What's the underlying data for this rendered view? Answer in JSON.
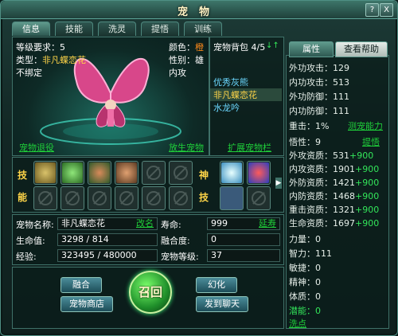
{
  "window": {
    "title": "宠物",
    "help_button": "?",
    "close_button": "X"
  },
  "tabs": [
    "信息",
    "技能",
    "洗灵",
    "提悟",
    "训练"
  ],
  "info": {
    "level_req": "等级要求：5",
    "type_label": "类型：",
    "type_value": "非凡蝶恋花",
    "bind": "不绑定",
    "color_label": "颜色：",
    "color_value": "橙",
    "gender_label": "性别：",
    "gender_value": "雄",
    "attack_type": "内攻",
    "unlink": "宠物退役",
    "reset": "放生宠物"
  },
  "bag": {
    "title": "宠物背包 4/5",
    "items": [
      "优秀灰熊",
      "非凡蝶恋花",
      "水龙吟"
    ],
    "expand": "扩展宠物栏"
  },
  "skills": {
    "label_left": "技\n能",
    "label_right": "神\n技"
  },
  "fields": {
    "name_label": "宠物名称:",
    "name_value": "非凡蝶恋花",
    "rename": "改名",
    "life_label": "寿命:",
    "life_value": "999",
    "extend": "延寿",
    "hp_label": "生命值:",
    "hp_value": "3298 / 814",
    "fusion_label": "融合度:",
    "fusion_value": "0",
    "exp_label": "经验:",
    "exp_value": "323495 / 480000",
    "petlevel_label": "宠物等级:",
    "petlevel_value": "37"
  },
  "buttons": {
    "merge": "融合",
    "shop": "宠物商店",
    "summon": "召回",
    "morph": "幻化",
    "chat": "发到聊天"
  },
  "right_tabs": [
    "属性",
    "查看帮助"
  ],
  "stats": {
    "ext_atk": "外功攻击：129",
    "int_atk": "内功攻击：513",
    "ext_def": "外功防御：111",
    "int_def": "内功防御：111",
    "crit": "重击：1%",
    "measure": "测宠能力",
    "wisdom": "悟性：9",
    "promote": "提悟",
    "apt": [
      {
        "k": "外攻资质：",
        "v": "531",
        "p": "+900"
      },
      {
        "k": "内攻资质：",
        "v": "1901",
        "p": "+900"
      },
      {
        "k": "外防资质：",
        "v": "1421",
        "p": "+900"
      },
      {
        "k": "内防资质：",
        "v": "1468",
        "p": "+900"
      },
      {
        "k": "重击资质：",
        "v": "1321",
        "p": "+900"
      },
      {
        "k": "生命资质：",
        "v": "1697",
        "p": "+900"
      }
    ],
    "attrs": [
      "力量：0",
      "智力：111",
      "敏捷：0",
      "精神：0",
      "体质：0"
    ],
    "potential": "潜能：0",
    "washpoint": "洗点"
  },
  "colors": {
    "accent": "#33e65a",
    "label_yellow": "#ffd548",
    "orange": "#ff8a1a"
  }
}
